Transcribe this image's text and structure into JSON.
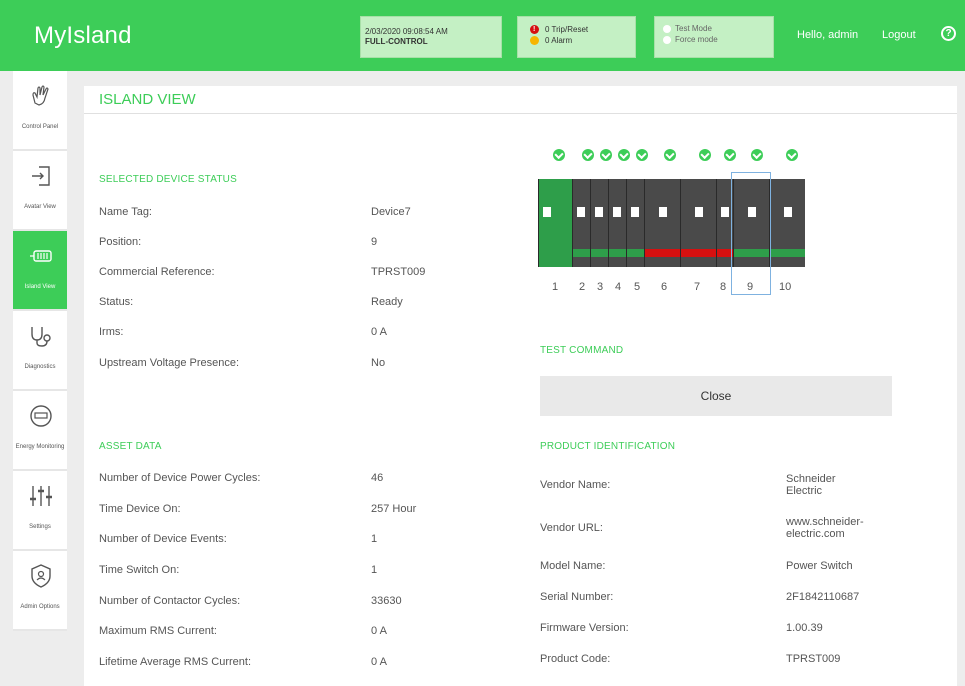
{
  "header": {
    "app_name": "MyIsland",
    "datetime": "2/03/2020 09:08:54 AM",
    "control_mode": "FULL-CONTROL",
    "trip_reset": "0 Trip/Reset",
    "alarm": "0 Alarm",
    "test_mode": "Test Mode",
    "force_mode": "Force mode",
    "greeting": "Hello, admin",
    "logout": "Logout",
    "help": "?"
  },
  "sidebar": {
    "items": [
      {
        "label": "Control Panel",
        "icon": "hand-icon"
      },
      {
        "label": "Avatar View",
        "icon": "login-icon"
      },
      {
        "label": "Island View",
        "icon": "battery-icon",
        "active": true
      },
      {
        "label": "Diagnostics",
        "icon": "stethoscope-icon"
      },
      {
        "label": "Energy Monitoring",
        "icon": "meter-icon"
      },
      {
        "label": "Settings",
        "icon": "sliders-icon"
      },
      {
        "label": "Admin Options",
        "icon": "shield-icon"
      }
    ]
  },
  "page": {
    "title": "ISLAND VIEW"
  },
  "device_status": {
    "heading": "SELECTED DEVICE STATUS",
    "rows": [
      {
        "label": "Name Tag:",
        "value": "Device7"
      },
      {
        "label": "Position:",
        "value": "9"
      },
      {
        "label": "Commercial Reference:",
        "value": "TPRST009"
      },
      {
        "label": "Status:",
        "value": "Ready"
      },
      {
        "label": "Irms:",
        "value": "0 A"
      },
      {
        "label": "Upstream Voltage Presence:",
        "value": "No"
      }
    ]
  },
  "asset_data": {
    "heading": "ASSET DATA",
    "rows": [
      {
        "label": "Number of Device Power Cycles:",
        "value": "46"
      },
      {
        "label": "Time Device On:",
        "value": "257 Hour"
      },
      {
        "label": "Number of Device Events:",
        "value": "1"
      },
      {
        "label": "Time Switch On:",
        "value": "1"
      },
      {
        "label": "Number of Contactor Cycles:",
        "value": "33630"
      },
      {
        "label": "Maximum RMS Current:",
        "value": "0 A"
      },
      {
        "label": "Lifetime Average RMS Current:",
        "value": "0 A"
      }
    ]
  },
  "devices": {
    "numbers": [
      "1",
      "2",
      "3",
      "4",
      "5",
      "6",
      "7",
      "8",
      "9",
      "10"
    ],
    "selected": "9"
  },
  "test_command": {
    "heading": "TEST COMMAND",
    "button": "Close"
  },
  "product_identification": {
    "heading": "PRODUCT IDENTIFICATION",
    "rows": [
      {
        "label": "Vendor Name:",
        "value_line1": "Schneider",
        "value_line2": "Electric"
      },
      {
        "label": "Vendor URL:",
        "value_line1": "www.schneider-",
        "value_line2": "electric.com"
      },
      {
        "label": "Model Name:",
        "value_line1": "Power Switch",
        "value_line2": ""
      },
      {
        "label": "Serial Number:",
        "value_line1": "2F1842110687",
        "value_line2": ""
      },
      {
        "label": "Firmware Version:",
        "value_line1": "1.00.39",
        "value_line2": ""
      },
      {
        "label": "Product Code:",
        "value_line1": "TPRST009",
        "value_line2": ""
      }
    ]
  },
  "colors": {
    "brand_green": "#3dcd58",
    "alert_red": "#d61010",
    "alert_yellow": "#f6b500",
    "selection_blue": "#7fb2e0"
  }
}
